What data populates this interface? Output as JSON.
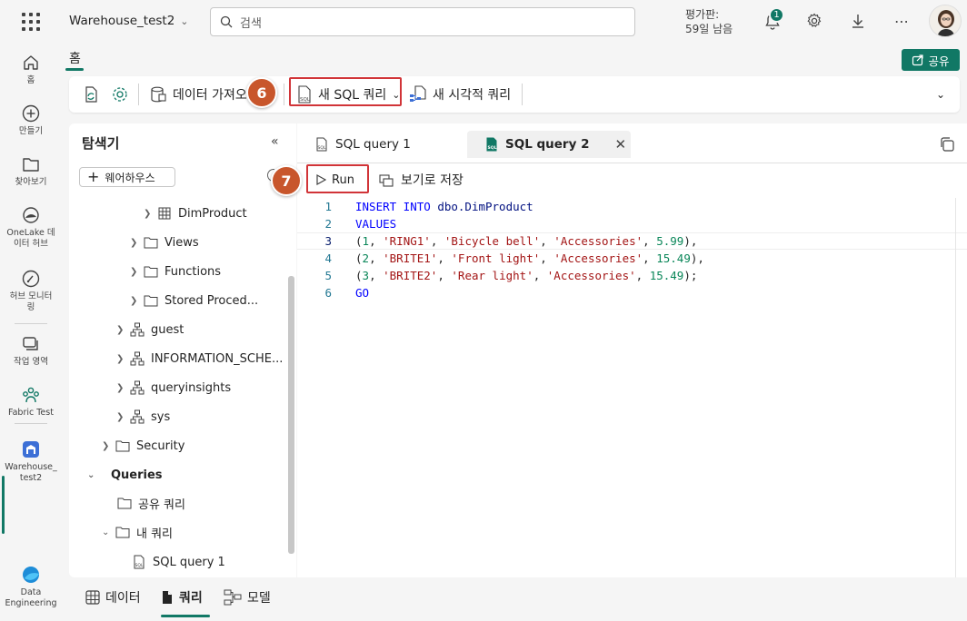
{
  "topbar": {
    "workspace_name": "Warehouse_test2",
    "search_placeholder": "검색",
    "trial_line1": "평가판:",
    "trial_line2": "59일 남음",
    "notification_count": "1"
  },
  "leftnav": {
    "home": "홈",
    "create": "만들기",
    "browse": "찾아보기",
    "onelake_line1": "OneLake 데",
    "onelake_line2": "이터 허브",
    "monitor_line1": "허브 모니터",
    "monitor_line2": "링",
    "workspaces": "작업 영역",
    "fabric_test": "Fabric Test",
    "warehouse_line1": "Warehouse_",
    "warehouse_line2": "test2",
    "data_eng_line1": "Data",
    "data_eng_line2": "Engineering"
  },
  "home_tab": "홈",
  "share_label": "공유",
  "ribbon": {
    "get_data": "데이터 가져오",
    "new_sql_query": "새 SQL 쿼리",
    "new_visual_query": "새 시각적 쿼리",
    "step6": "6"
  },
  "explorer": {
    "title": "탐색기",
    "add_warehouse": "웨어하우스",
    "items": {
      "dimproduct": "DimProduct",
      "views": "Views",
      "functions": "Functions",
      "stored_procedures": "Stored Proced...",
      "guest": "guest",
      "information_schema": "INFORMATION_SCHE...",
      "queryinsights": "queryinsights",
      "sys": "sys",
      "security": "Security",
      "queries": "Queries",
      "shared_queries": "공유 쿼리",
      "my_queries": "내 쿼리",
      "sql_query_1": "SQL query 1"
    }
  },
  "editor": {
    "tab1": "SQL query 1",
    "tab2": "SQL query 2",
    "run_label": "Run",
    "save_as_view": "보기로 저장",
    "step7": "7",
    "lines": [
      {
        "n": "1"
      },
      {
        "n": "2"
      },
      {
        "n": "3"
      },
      {
        "n": "4"
      },
      {
        "n": "5"
      },
      {
        "n": "6"
      }
    ],
    "code": {
      "l1_kw": "INSERT INTO",
      "l1_id": " dbo.DimProduct",
      "l2_kw": "VALUES",
      "l3": {
        "a": "(",
        "n1": "1",
        "s1": "'RING1'",
        "s2": "'Bicycle bell'",
        "s3": "'Accessories'",
        "n2": "5.99",
        "end": "),"
      },
      "l4": {
        "a": "(",
        "n1": "2",
        "s1": "'BRITE1'",
        "s2": "'Front light'",
        "s3": "'Accessories'",
        "n2": "15.49",
        "end": "),"
      },
      "l5": {
        "a": "(",
        "n1": "3",
        "s1": "'BRITE2'",
        "s2": "'Rear light'",
        "s3": "'Accessories'",
        "n2": "15.49",
        "end": ");"
      },
      "l6_kw": "GO"
    }
  },
  "bottom_tabs": {
    "data": "데이터",
    "query": "쿼리",
    "model": "모델"
  },
  "colors": {
    "accent": "#117865",
    "highlight_box": "#d13438",
    "step_badge": "#c8562c"
  }
}
